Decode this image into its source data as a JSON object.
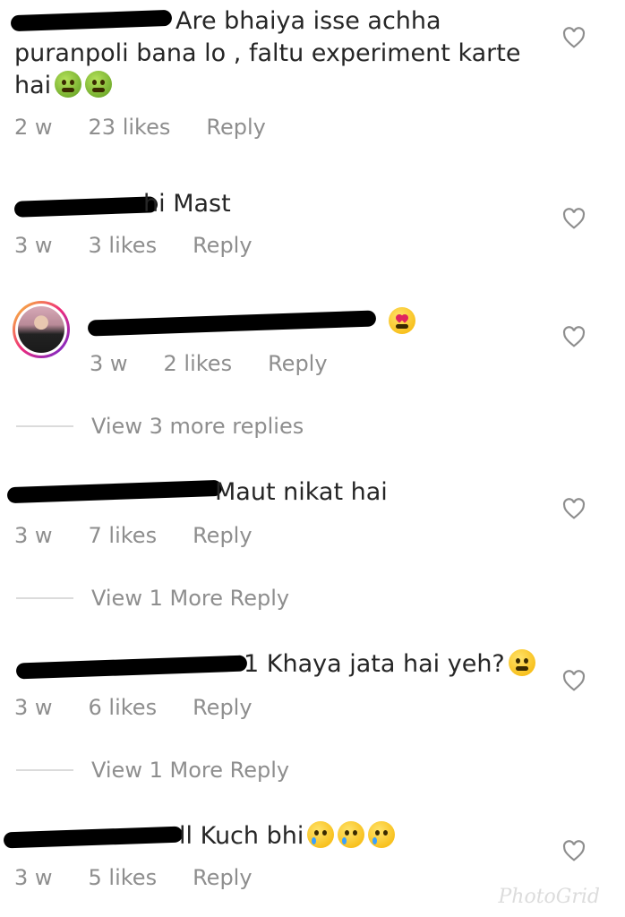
{
  "comments": [
    {
      "text_line1": "Are bhaiya isse achha",
      "text_line2": "puranpoli bana lo , faltu experiment karte",
      "text_line3": "hai",
      "emojis": [
        "nauseated-face-icon",
        "vomiting-face-icon"
      ],
      "time": "2 w",
      "likes": "23 likes",
      "reply": "Reply"
    },
    {
      "text": "hi Mast",
      "time": "3 w",
      "likes": "3 likes",
      "reply": "Reply"
    },
    {
      "text": "",
      "emojis": [
        "heart-eyes-face-icon"
      ],
      "time": "3 w",
      "likes": "2 likes",
      "reply": "Reply"
    },
    {
      "text": "Maut nikat hai",
      "time": "3 w",
      "likes": "7 likes",
      "reply": "Reply"
    },
    {
      "text": "1 Khaya jata hai yeh?",
      "emojis": [
        "eye-roll-face-icon"
      ],
      "time": "3 w",
      "likes": "6 likes",
      "reply": "Reply"
    },
    {
      "text": "ll Kuch bhi",
      "emojis": [
        "crying-face-icon",
        "crying-face-icon",
        "crying-face-icon"
      ],
      "time": "3 w",
      "likes": "5 likes",
      "reply": "Reply"
    }
  ],
  "view_replies": [
    "View 3 more replies",
    "View 1 More Reply",
    "View 1 More Reply"
  ],
  "watermark": "PhotoGrid",
  "colors": {
    "text": "#262626",
    "meta": "#8e8e8e",
    "divider": "#dbdbdb"
  }
}
